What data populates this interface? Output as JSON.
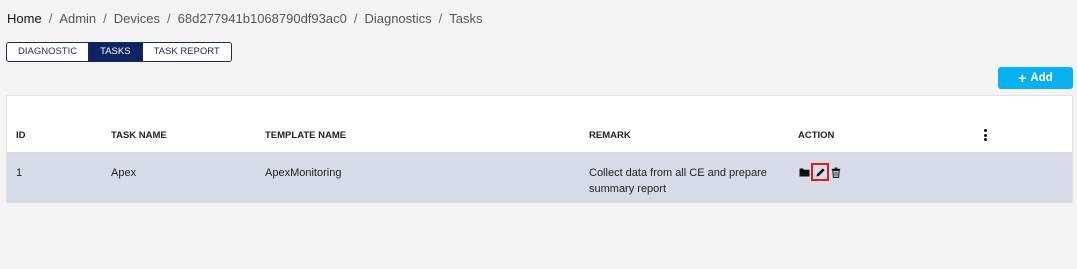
{
  "breadcrumb": {
    "items": [
      "Home",
      "Admin",
      "Devices",
      "68d277941b1068790df93ac0",
      "Diagnostics",
      "Tasks"
    ],
    "separator": "/"
  },
  "tabs": [
    {
      "label": "DIAGNOSTIC",
      "active": false
    },
    {
      "label": "TASKS",
      "active": true
    },
    {
      "label": "TASK REPORT",
      "active": false
    }
  ],
  "toolbar": {
    "add_label": "Add",
    "add_icon": "plus-icon"
  },
  "table": {
    "columns": [
      "ID",
      "TASK NAME",
      "TEMPLATE NAME",
      "REMARK",
      "ACTION"
    ],
    "rows": [
      {
        "id": "1",
        "task_name": "Apex",
        "template_name": "ApexMonitoring",
        "remark_line1": "Collect data from all CE and prepare",
        "remark_line2": "summary report",
        "actions": [
          "folder-icon",
          "edit-pencil-icon",
          "trash-icon"
        ]
      }
    ],
    "column_menu_icon": "vertical-dots-icon"
  },
  "colors": {
    "tab_active": "#0f2363",
    "add_button": "#0ab1f2",
    "row_bg": "#d5dce8",
    "focus_outline": "#e01b1b"
  }
}
